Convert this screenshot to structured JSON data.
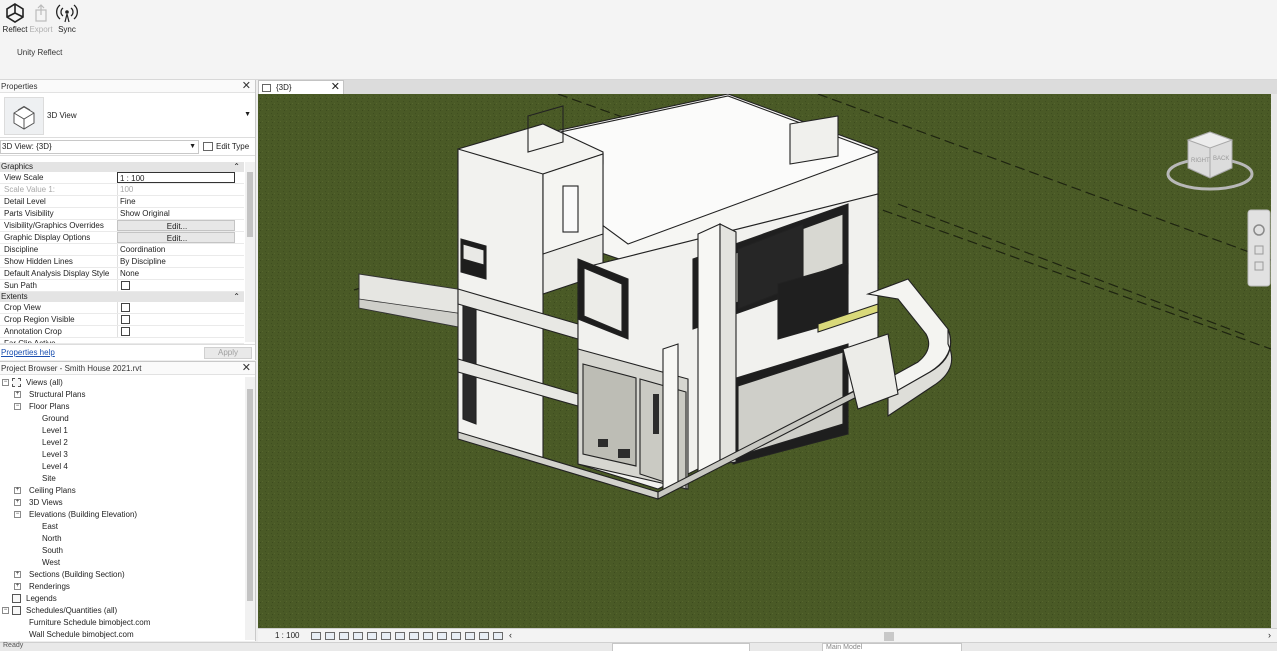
{
  "ribbon": {
    "buttons": [
      {
        "label": "Reflect",
        "icon": "unity-logo-icon",
        "enabled": true
      },
      {
        "label": "Export",
        "icon": "export-icon",
        "enabled": false
      },
      {
        "label": "Sync",
        "icon": "sync-signal-icon",
        "enabled": true
      }
    ],
    "panel_label": "Unity Reflect"
  },
  "properties": {
    "title": "Properties",
    "type_name": "3D View",
    "view_selector": "3D View: {3D}",
    "edit_type_label": "Edit Type",
    "groups": {
      "graphics": "Graphics",
      "extents": "Extents"
    },
    "rows": {
      "view_scale": {
        "key": "View Scale",
        "value": "1 : 100"
      },
      "scale_value": {
        "key": "Scale Value    1:",
        "value": "100"
      },
      "detail_level": {
        "key": "Detail Level",
        "value": "Fine"
      },
      "parts_visibility": {
        "key": "Parts Visibility",
        "value": "Show Original"
      },
      "vg_overrides": {
        "key": "Visibility/Graphics Overrides",
        "value": "Edit..."
      },
      "graphic_display": {
        "key": "Graphic Display Options",
        "value": "Edit..."
      },
      "discipline": {
        "key": "Discipline",
        "value": "Coordination"
      },
      "hidden_lines": {
        "key": "Show Hidden Lines",
        "value": "By Discipline"
      },
      "analysis_style": {
        "key": "Default Analysis Display Style",
        "value": "None"
      },
      "sun_path": {
        "key": "Sun Path"
      },
      "crop_view": {
        "key": "Crop View"
      },
      "crop_region": {
        "key": "Crop Region Visible"
      },
      "annotation_crop": {
        "key": "Annotation Crop"
      },
      "far_clip": {
        "key": "Far Clip Active"
      }
    },
    "help_link": "Properties help",
    "apply_label": "Apply"
  },
  "browser": {
    "title": "Project Browser - Smith House 2021.rvt",
    "tree": {
      "views": "Views (all)",
      "structural_plans": "Structural Plans",
      "floor_plans": "Floor Plans",
      "ground": "Ground",
      "level1": "Level 1",
      "level2": "Level 2",
      "level3": "Level 3",
      "level4": "Level 4",
      "site": "Site",
      "ceiling_plans": "Ceiling Plans",
      "views_3d": "3D Views",
      "elevations": "Elevations (Building Elevation)",
      "east": "East",
      "north": "North",
      "south": "South",
      "west": "West",
      "sections": "Sections (Building Section)",
      "renderings": "Renderings",
      "legends": "Legends",
      "schedules": "Schedules/Quantities (all)",
      "furniture_schedule": "Furniture Schedule bimobject.com",
      "wall_schedule": "Wall Schedule bimobject.com"
    }
  },
  "view": {
    "tab_label": "{3D}",
    "scale": "1 : 100",
    "viewcube_labels": {
      "left": "RIGHT",
      "right": "BACK"
    }
  },
  "statusbar": {
    "text": "Ready",
    "model_placeholder": "Main Model"
  },
  "colors": {
    "ground": "#4a5a26",
    "building": "#f2f2ef",
    "glass": "#1d1d1d",
    "accent_yellow": "#d9d97a"
  }
}
